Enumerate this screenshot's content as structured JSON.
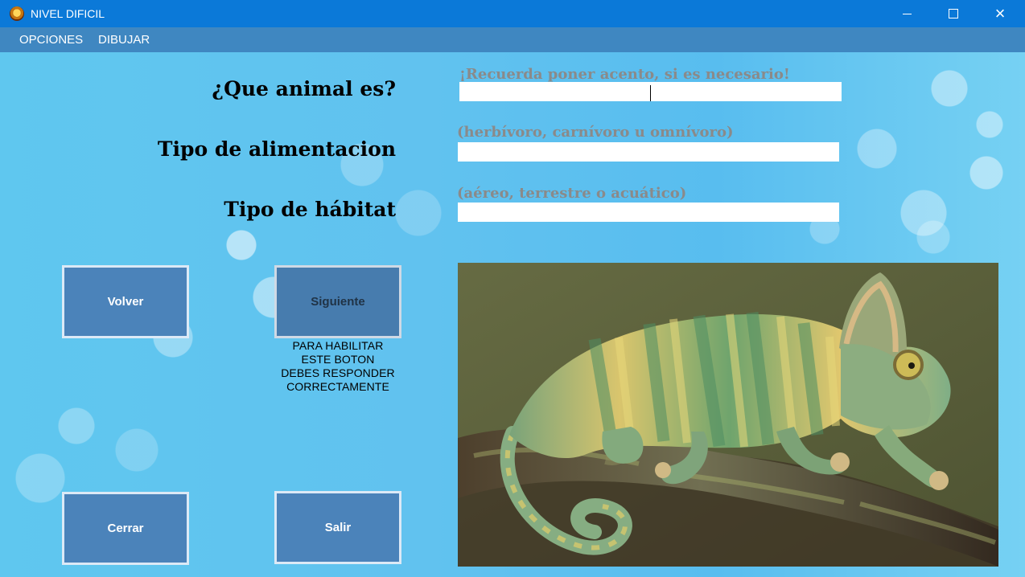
{
  "window": {
    "title": "NIVEL DIFICIL",
    "controls": {
      "minimize": "minimize",
      "maximize": "maximize",
      "close": "×"
    }
  },
  "menu": {
    "items": [
      "OPCIONES",
      "DIBUJAR"
    ]
  },
  "questions": {
    "animal": "¿Que animal es?",
    "food": "Tipo de alimentacion",
    "habitat": "Tipo de hábitat"
  },
  "hints": {
    "animal": "¡Recuerda poner acento, si es necesario!",
    "food": "(herbívoro, carnívoro u omnívoro)",
    "habitat": "(aéreo, terrestre o acuático)"
  },
  "inputs": {
    "animal": "",
    "food": "",
    "habitat": ""
  },
  "buttons": {
    "back": "Volver",
    "next": "Siguiente",
    "close": "Cerrar",
    "exit": "Salir"
  },
  "next_note": [
    "PARA HABILITAR",
    "ESTE BOTON",
    "DEBES RESPONDER",
    "CORRECTAMENTE"
  ],
  "colors": {
    "titlebar": "#0b79d8",
    "menubar": "#3f87c1",
    "button": "#4b83ba",
    "hint": "#8a8a8a"
  },
  "icons": {
    "app": "app-icon",
    "animal_image": "chameleon-image"
  }
}
